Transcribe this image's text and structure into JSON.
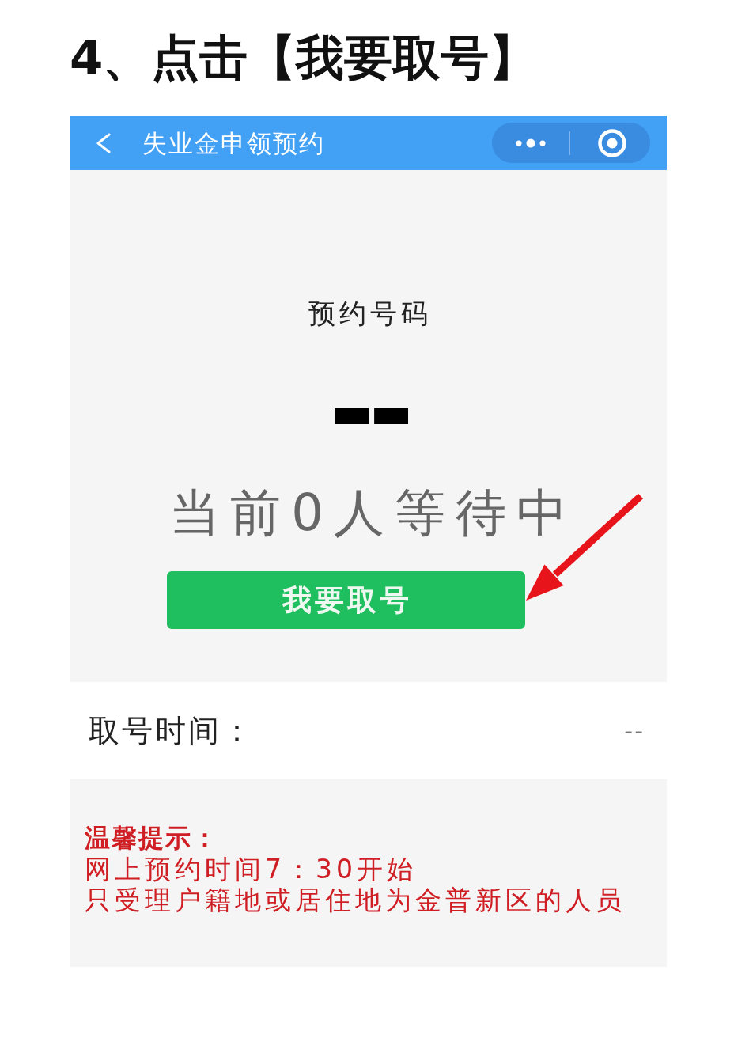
{
  "heading": "4、点击【我要取号】",
  "screen": {
    "nav_bar": {
      "title": "失业金申领预约"
    },
    "reservation": {
      "label": "预约号码",
      "number": "--",
      "queue_status": "当前0人等待中",
      "button": "我要取号"
    },
    "pickup_time": {
      "label": "取号时间：",
      "value": "--"
    },
    "notice": {
      "title": "温馨提示：",
      "lines": [
        "网上预约时间7：30开始",
        "只受理户籍地或居住地为金普新区的人员"
      ]
    }
  }
}
